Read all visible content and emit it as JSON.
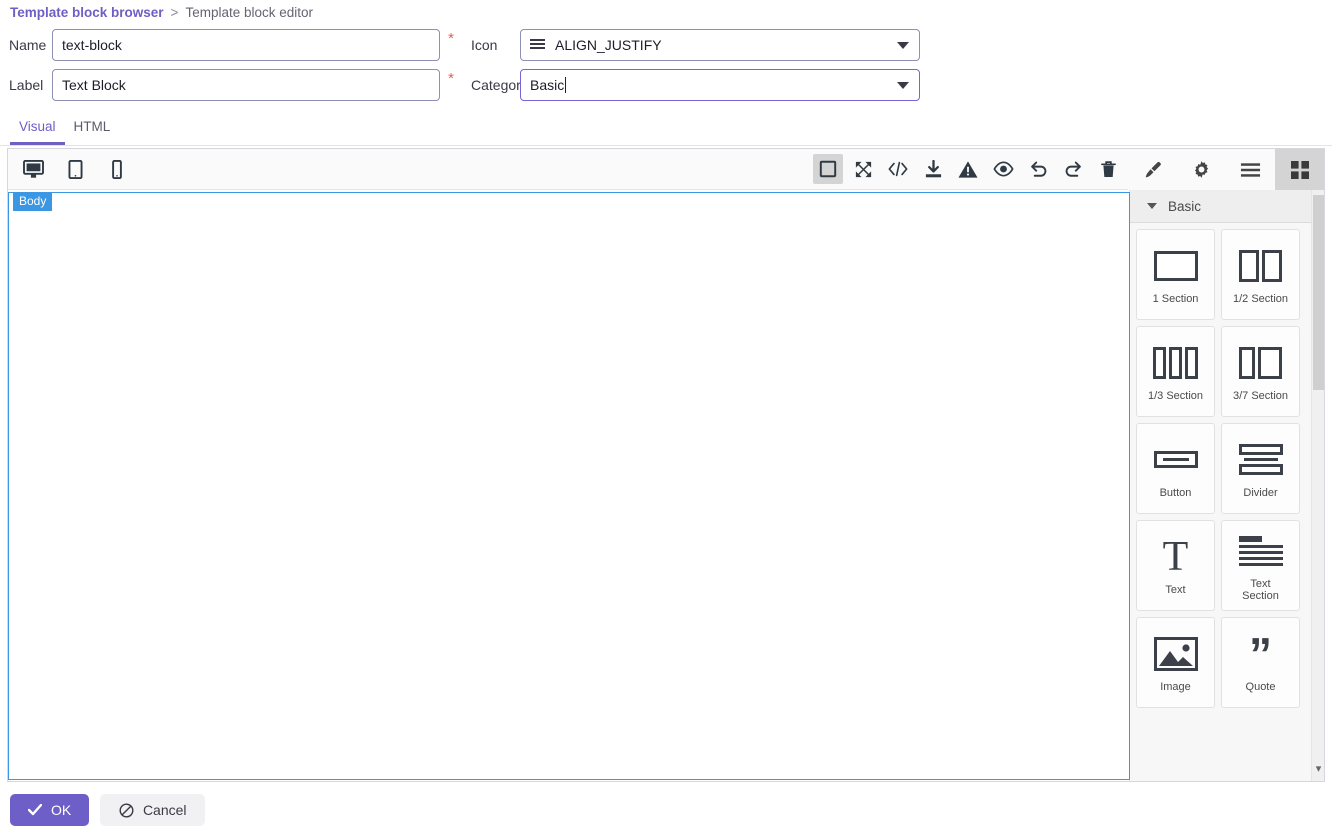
{
  "breadcrumb": {
    "link": "Template block browser",
    "separator": ">",
    "current": "Template block editor"
  },
  "form": {
    "name": {
      "label": "Name",
      "value": "text-block",
      "required_marker": "*"
    },
    "label": {
      "label": "Label",
      "value": "Text Block",
      "required_marker": "*"
    },
    "icon": {
      "label": "Icon",
      "value": "ALIGN_JUSTIFY",
      "icon_name": "align-justify-icon",
      "required_marker": "*"
    },
    "category": {
      "label": "Category",
      "value": "Basic",
      "required_marker": "*",
      "focused": true
    }
  },
  "tabs": [
    {
      "label": "Visual",
      "active": true
    },
    {
      "label": "HTML",
      "active": false
    }
  ],
  "toolbar": {
    "devices": [
      {
        "name": "desktop-icon",
        "title": "Desktop",
        "active": true
      },
      {
        "name": "tablet-icon",
        "title": "Tablet",
        "active": false
      },
      {
        "name": "mobile-icon",
        "title": "Mobile",
        "active": false
      }
    ],
    "options": [
      {
        "name": "borders-icon",
        "title": "View components",
        "active": true
      },
      {
        "name": "fullscreen-icon",
        "title": "Fullscreen",
        "active": false
      },
      {
        "name": "code-icon",
        "title": "View code",
        "active": false
      },
      {
        "name": "import-icon",
        "title": "Import",
        "active": false
      },
      {
        "name": "warning-icon",
        "title": "Warnings",
        "active": false
      },
      {
        "name": "eye-icon",
        "title": "Preview",
        "active": false
      },
      {
        "name": "undo-icon",
        "title": "Undo",
        "active": false
      },
      {
        "name": "redo-icon",
        "title": "Redo",
        "active": false
      },
      {
        "name": "trash-icon",
        "title": "Clear canvas",
        "active": false
      }
    ],
    "panel_tabs": [
      {
        "name": "brush-icon",
        "title": "Style Manager",
        "active": false
      },
      {
        "name": "gear-icon",
        "title": "Settings",
        "active": false
      },
      {
        "name": "layers-icon",
        "title": "Layer Manager",
        "active": false
      },
      {
        "name": "blocks-icon",
        "title": "Blocks",
        "active": true
      }
    ]
  },
  "canvas": {
    "badge": "Body",
    "badge_color": "#3b97e3",
    "border_color": "#3b97e3"
  },
  "blocks_panel": {
    "category": {
      "label": "Basic",
      "expanded": true
    },
    "blocks": [
      {
        "label": "1 Section",
        "icon": "one-section-icon"
      },
      {
        "label": "1/2 Section",
        "icon": "half-section-icon"
      },
      {
        "label": "1/3 Section",
        "icon": "third-section-icon"
      },
      {
        "label": "3/7 Section",
        "icon": "three-seven-section-icon"
      },
      {
        "label": "Button",
        "icon": "button-block-icon"
      },
      {
        "label": "Divider",
        "icon": "divider-block-icon"
      },
      {
        "label": "Text",
        "icon": "text-block-icon"
      },
      {
        "label": "Text\nSection",
        "icon": "text-section-block-icon"
      },
      {
        "label": "Image",
        "icon": "image-block-icon"
      },
      {
        "label": "Quote",
        "icon": "quote-block-icon"
      }
    ]
  },
  "footer": {
    "ok": {
      "label": "OK",
      "icon": "check-icon"
    },
    "cancel": {
      "label": "Cancel",
      "icon": "ban-icon"
    }
  },
  "colors": {
    "accent_purple": "#6e5ec8",
    "link_purple": "#6f5ec4",
    "canvas_blue": "#3b97e3",
    "required_red": "#e8604c"
  }
}
